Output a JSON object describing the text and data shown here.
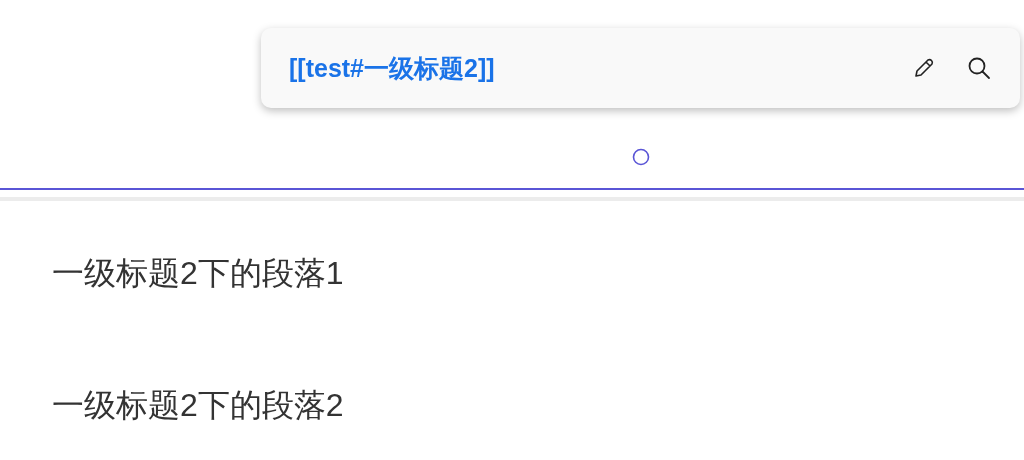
{
  "link_preview": {
    "link": "[[test#一级标题2]]"
  },
  "paragraphs": [
    "一级标题2下的段落1",
    "一级标题2下的段落2"
  ]
}
